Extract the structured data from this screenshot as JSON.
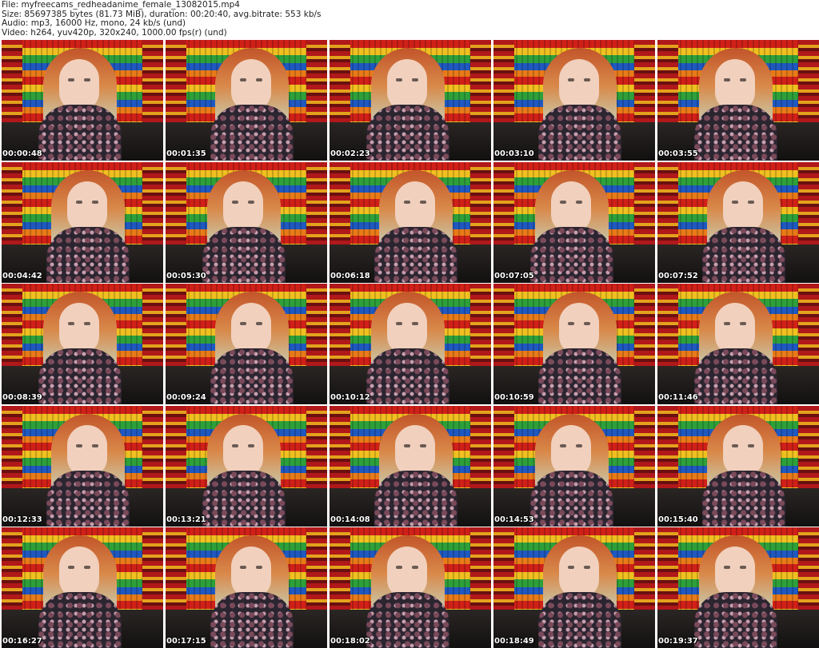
{
  "header": {
    "file": "File: myfreecams_redheadanime_female_13082015.mp4",
    "size": "Size: 85697385 bytes (81.73 MiB), duration: 00:20:40, avg.bitrate: 553 kb/s",
    "audio": "Audio: mp3, 16000 Hz, mono, 24 kb/s (und)",
    "video": "Video: h264, yuv420p, 320x240, 1000.00 fps(r) (und)"
  },
  "frames": [
    {
      "timestamp": "00:00:48"
    },
    {
      "timestamp": "00:01:35"
    },
    {
      "timestamp": "00:02:23"
    },
    {
      "timestamp": "00:03:10"
    },
    {
      "timestamp": "00:03:55"
    },
    {
      "timestamp": "00:04:42"
    },
    {
      "timestamp": "00:05:30"
    },
    {
      "timestamp": "00:06:18"
    },
    {
      "timestamp": "00:07:05"
    },
    {
      "timestamp": "00:07:52"
    },
    {
      "timestamp": "00:08:39"
    },
    {
      "timestamp": "00:09:24"
    },
    {
      "timestamp": "00:10:12"
    },
    {
      "timestamp": "00:10:59"
    },
    {
      "timestamp": "00:11:46"
    },
    {
      "timestamp": "00:12:33"
    },
    {
      "timestamp": "00:13:21"
    },
    {
      "timestamp": "00:14:08"
    },
    {
      "timestamp": "00:14:53"
    },
    {
      "timestamp": "00:15:40"
    },
    {
      "timestamp": "00:16:27"
    },
    {
      "timestamp": "00:17:15"
    },
    {
      "timestamp": "00:18:02"
    },
    {
      "timestamp": "00:18:49"
    },
    {
      "timestamp": "00:19:37"
    }
  ]
}
